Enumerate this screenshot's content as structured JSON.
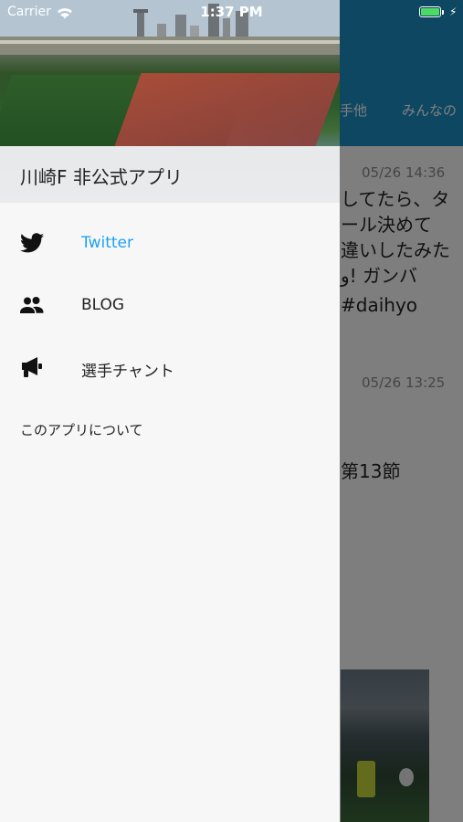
{
  "status_bar": {
    "carrier": "Carrier",
    "time": "1:37 PM"
  },
  "drawer": {
    "title": "川崎F 非公式アプリ",
    "items": [
      {
        "label": "Twitter",
        "icon": "twitter-bird-icon",
        "active": true
      },
      {
        "label": "BLOG",
        "icon": "people-icon",
        "active": false
      },
      {
        "label": "選手チャント",
        "icon": "megaphone-icon",
        "active": false
      },
      {
        "label": "このアプリについて",
        "icon": null,
        "active": false
      }
    ]
  },
  "background": {
    "tabs": [
      "手他",
      "みんなの"
    ],
    "post1": {
      "time": "05/26 14:36",
      "lines": [
        "してたら、タ",
        "ール決めて",
        "違いしたみた",
        "ﻭ! ガンバ",
        "#daihyo"
      ]
    },
    "post2": {
      "time": "05/26 13:25",
      "lines": [
        "第13節"
      ]
    }
  },
  "colors": {
    "accent": "#1da1f2",
    "header": "#1a8fc4",
    "battery": "#4cd964"
  }
}
